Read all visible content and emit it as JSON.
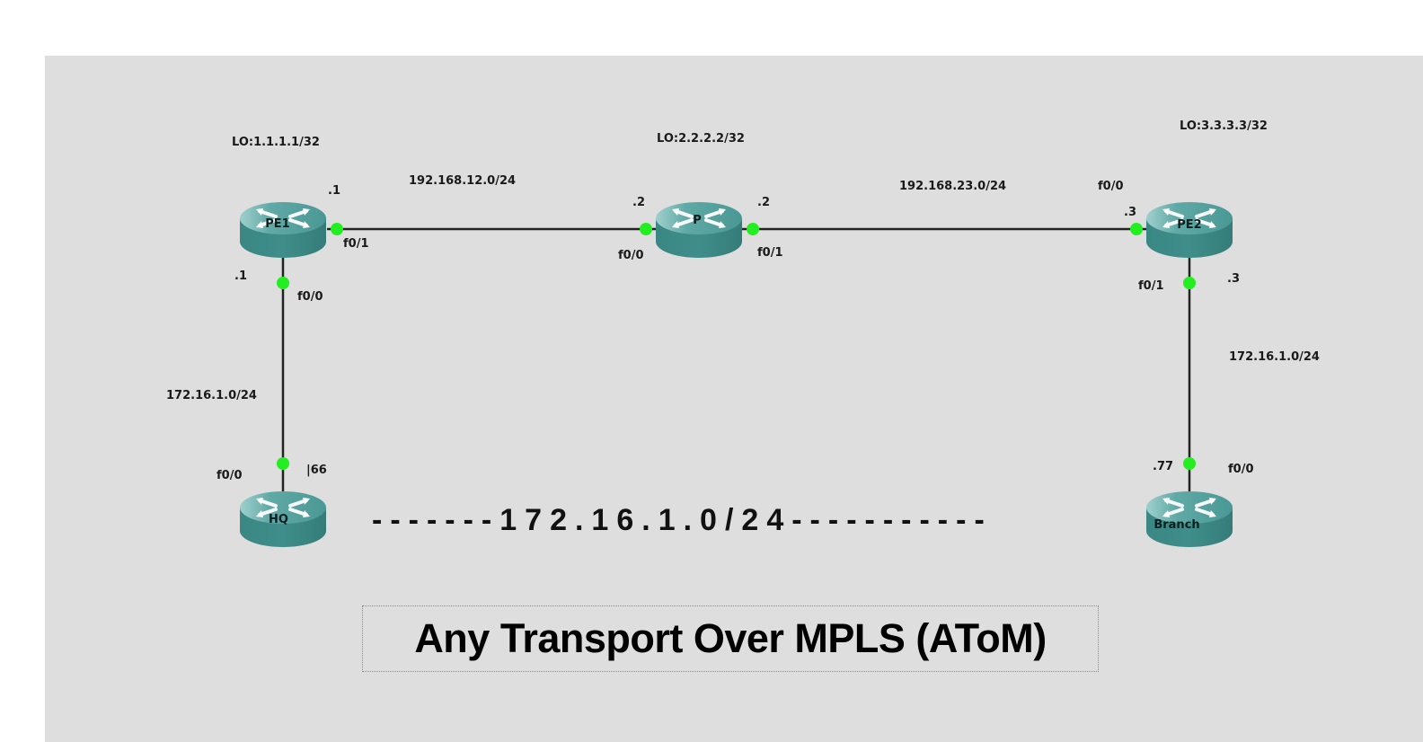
{
  "diagram": {
    "title": "Any Transport Over MPLS (AToM)",
    "pseudowire_label": "-------172.16.1.0/24-----------",
    "colors": {
      "canvas_bg": "#dedede",
      "router_body": "#3d8a87",
      "router_top": "#5aa5a2",
      "link": "#222222",
      "interface_up": "#22ee22"
    },
    "routers": [
      {
        "id": "PE1",
        "name": "PE1",
        "loopback": "LO:1.1.1.1/32"
      },
      {
        "id": "P",
        "name": "P",
        "loopback": "LO:2.2.2.2/32"
      },
      {
        "id": "PE2",
        "name": "PE2",
        "loopback": "LO:3.3.3.3/32"
      },
      {
        "id": "HQ",
        "name": "HQ",
        "loopback": ""
      },
      {
        "id": "Branch",
        "name": "Branch",
        "loopback": ""
      }
    ],
    "links": [
      {
        "from": "PE1",
        "to": "P",
        "subnet": "192.168.12.0/24",
        "a_if": "f0/1",
        "a_ip": ".1",
        "b_if": "f0/0",
        "b_ip": ".2"
      },
      {
        "from": "P",
        "to": "PE2",
        "subnet": "192.168.23.0/24",
        "a_if": "f0/1",
        "a_ip": ".2",
        "b_if": "f0/0",
        "b_ip": ".3"
      },
      {
        "from": "PE1",
        "to": "HQ",
        "subnet": "172.16.1.0/24",
        "a_if": "f0/0",
        "a_ip": ".1",
        "b_if": "f0/0",
        "b_ip": "|66"
      },
      {
        "from": "PE2",
        "to": "Branch",
        "subnet": "172.16.1.0/24",
        "a_if": "f0/1",
        "a_ip": ".3",
        "b_if": "f0/0",
        "b_ip": ".77"
      }
    ]
  }
}
